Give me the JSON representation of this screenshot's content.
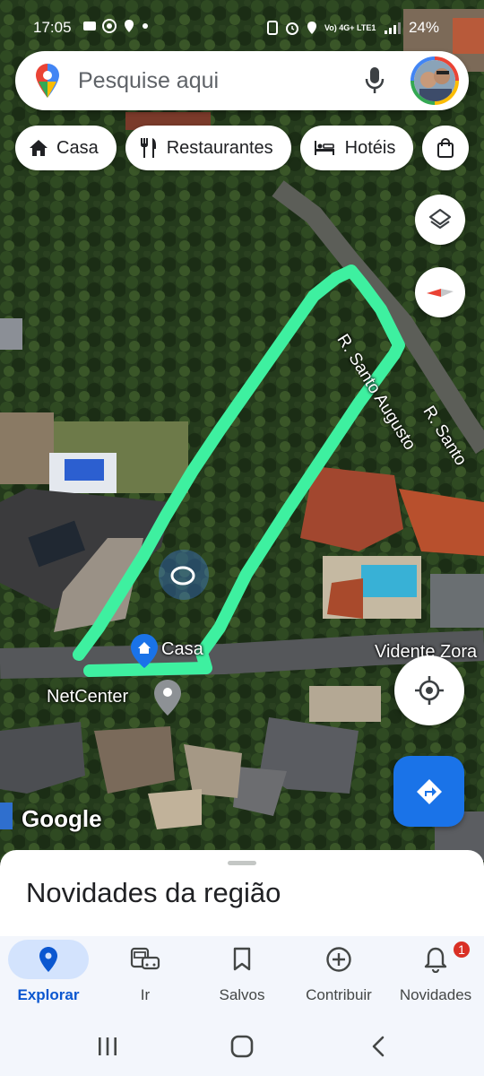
{
  "status_bar": {
    "time": "17:05",
    "network_label": "Vo) 4G+ LTE1",
    "battery": "24%"
  },
  "search": {
    "placeholder": "Pesquise aqui",
    "icons": [
      "maps-pin-icon",
      "mic-icon",
      "profile-avatar"
    ]
  },
  "chips": [
    {
      "label": "Casa",
      "icon": "home-icon"
    },
    {
      "label": "Restaurantes",
      "icon": "restaurant-icon"
    },
    {
      "label": "Hotéis",
      "icon": "hotel-icon"
    },
    {
      "label": "",
      "icon": "shopping-icon"
    }
  ],
  "map": {
    "street_labels": [
      "R. Santo Augusto",
      "R. Santo"
    ],
    "places": [
      {
        "label": "Casa",
        "icon": "home-pin-icon"
      },
      {
        "label": "NetCenter",
        "icon": "location-pin-icon"
      },
      {
        "label": "Vidente Zora",
        "icon": ""
      }
    ],
    "attribution": "Google",
    "highlight_color": "#3ef0a0",
    "user_location_color": "#4285f4"
  },
  "controls": {
    "layers": "layers-icon",
    "compass": "compass-icon",
    "my_location": "my-location-icon",
    "directions": "directions-icon"
  },
  "sheet": {
    "title": "Novidades da região"
  },
  "nav": {
    "items": [
      {
        "label": "Explorar",
        "icon": "explore-pin-icon",
        "active": true
      },
      {
        "label": "Ir",
        "icon": "commute-icon"
      },
      {
        "label": "Salvos",
        "icon": "bookmark-icon"
      },
      {
        "label": "Contribuir",
        "icon": "add-circle-icon"
      },
      {
        "label": "Novidades",
        "icon": "bell-icon",
        "badge": "1"
      }
    ],
    "accent": "#0b57d0"
  },
  "system_nav": [
    "recents-icon",
    "home-icon",
    "back-icon"
  ]
}
